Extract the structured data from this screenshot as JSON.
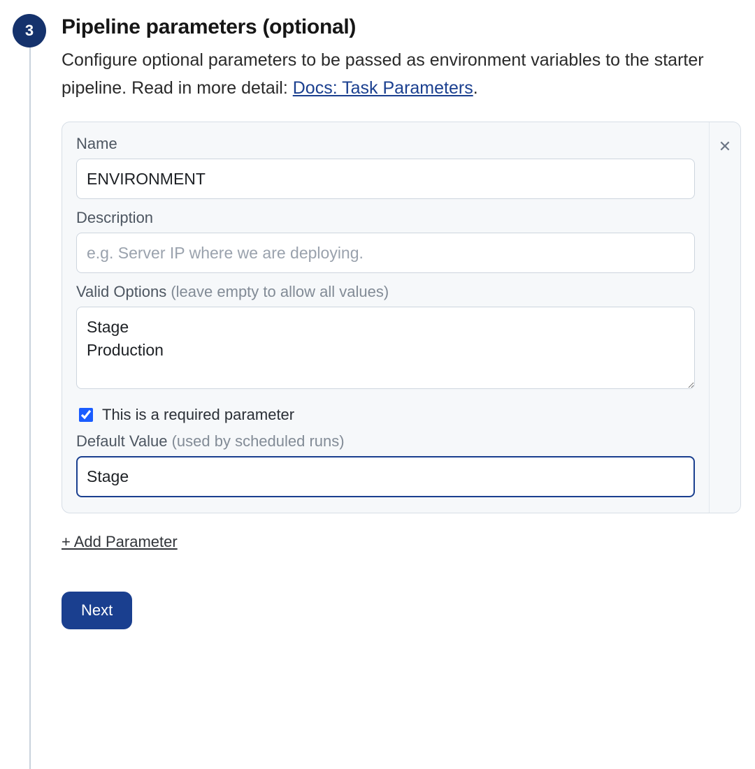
{
  "step": {
    "number": "3",
    "title": "Pipeline parameters (optional)",
    "description_pre": "Configure optional parameters to be passed as environment variables to the starter pipeline. Read in more detail: ",
    "description_link": "Docs: Task Parameters",
    "description_post": "."
  },
  "param": {
    "name_label": "Name",
    "name_value": "ENVIRONMENT",
    "description_label": "Description",
    "description_placeholder": "e.g. Server IP where we are deploying.",
    "description_value": "",
    "valid_options_label": "Valid Options ",
    "valid_options_hint": "(leave empty to allow all values)",
    "valid_options_value": "Stage\nProduction",
    "required_label": "This is a required parameter",
    "required_checked": true,
    "default_label": "Default Value ",
    "default_hint": "(used by scheduled runs)",
    "default_value": "Stage",
    "close_glyph": "✕"
  },
  "actions": {
    "add_parameter": "+ Add Parameter",
    "next": "Next"
  }
}
